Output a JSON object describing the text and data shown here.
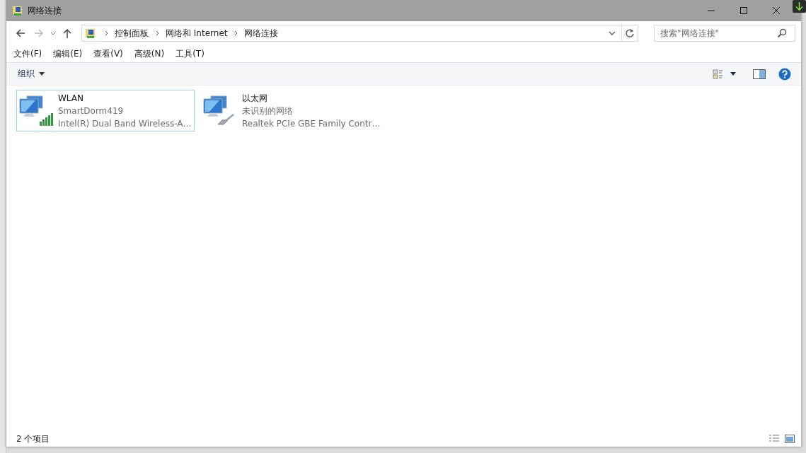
{
  "window": {
    "title": "网络连接"
  },
  "address_bar": {
    "breadcrumbs": [
      "控制面板",
      "网络和 Internet",
      "网络连接"
    ]
  },
  "search": {
    "placeholder": "搜索\"网络连接\""
  },
  "menu": [
    "文件(F)",
    "编辑(E)",
    "查看(V)",
    "高级(N)",
    "工具(T)"
  ],
  "toolbar": {
    "organize": "组织"
  },
  "connections": [
    {
      "name": "WLAN",
      "status": "SmartDorm419",
      "adapter": "Intel(R) Dual Band Wireless-A…",
      "kind": "wireless",
      "selected": true
    },
    {
      "name": "以太网",
      "status": "未识别的网络",
      "adapter": "Realtek PCIe GBE Family Contr…",
      "kind": "ethernet",
      "selected": false
    }
  ],
  "status_bar": {
    "count": "2 个项目"
  }
}
